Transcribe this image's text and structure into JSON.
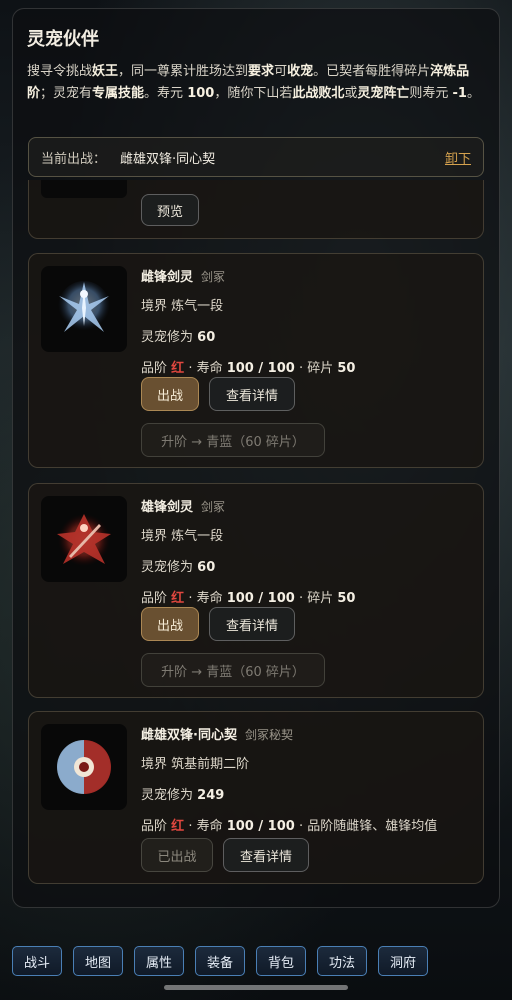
{
  "panel": {
    "title": "灵宠伙伴",
    "desc": {
      "p1": "搜寻令挑战",
      "b1": "妖王",
      "p2": "，同一尊累计胜场达到",
      "b2": "要求",
      "p3": "可",
      "b3": "收宠",
      "p4": "。已契者每胜得碎片",
      "b4": "淬炼品阶",
      "p5": "；灵宠有",
      "b5": "专属技能",
      "p6": "。寿元 ",
      "b6": "100",
      "p7": "，随你下山若",
      "b7": "此战败北",
      "p8": "或",
      "b8": "灵宠阵亡",
      "p9": "则寿元 ",
      "b9": "-1",
      "p10": "。"
    },
    "current": {
      "label": "当前出战：",
      "name": "雌雄双锋·同心契",
      "unequip": "卸下"
    },
    "preview_label": "预览",
    "pets": [
      {
        "name": "雌锋剑灵",
        "tag": "剑冢",
        "realm_label": "境界",
        "realm": "炼气一段",
        "cult_label": "灵宠修为",
        "cult": "60",
        "grade_label": "品阶",
        "grade": "红",
        "life_label": "· 寿命",
        "life": "100 / 100",
        "frag_label": "· 碎片",
        "frag": "50",
        "btn_go": "出战",
        "btn_detail": "查看详情",
        "btn_upgrade": "升阶 → 青蓝（60 碎片）"
      },
      {
        "name": "雄锋剑灵",
        "tag": "剑冢",
        "realm_label": "境界",
        "realm": "炼气一段",
        "cult_label": "灵宠修为",
        "cult": "60",
        "grade_label": "品阶",
        "grade": "红",
        "life_label": "· 寿命",
        "life": "100 / 100",
        "frag_label": "· 碎片",
        "frag": "50",
        "btn_go": "出战",
        "btn_detail": "查看详情",
        "btn_upgrade": "升阶 → 青蓝（60 碎片）"
      },
      {
        "name": "雌雄双锋·同心契",
        "tag": "剑冢秘契",
        "realm_label": "境界",
        "realm": "筑基前期二阶",
        "cult_label": "灵宠修为",
        "cult": "249",
        "grade_label": "品阶",
        "grade": "红",
        "life_label": "· 寿命",
        "life": "100 / 100",
        "extra": "· 品阶随雌锋、雄锋均值",
        "btn_done": "已出战",
        "btn_detail": "查看详情"
      }
    ]
  },
  "nav": [
    "战斗",
    "地图",
    "属性",
    "装备",
    "背包",
    "功法",
    "洞府"
  ],
  "colors": {
    "grade_red": "#e0473f",
    "unequip_link": "#d4a14e",
    "nav_border": "#4a7fb5"
  }
}
